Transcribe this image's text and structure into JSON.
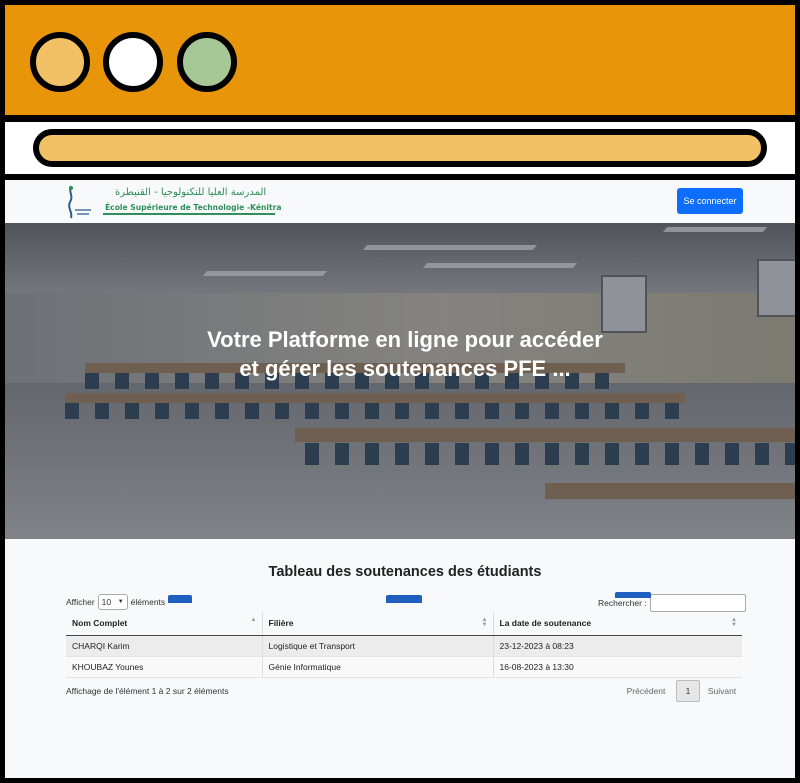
{
  "navbar": {
    "logo_arabic": "المدرسة العليا للتكنولوجيا - القنيطرة",
    "logo_latin": "École Supérieure de Technologie -Kénitra",
    "login_label": "Se connecter"
  },
  "hero": {
    "title": "Votre Platforme en ligne pour accéder et gérer les soutenances PFE ..."
  },
  "table_section": {
    "title": "Tableau des soutenances des étudiants",
    "length_prefix": "Afficher",
    "length_value": "10",
    "length_suffix": "éléments",
    "search_label": "Rechercher :",
    "columns": [
      "Nom Complet",
      "Filière",
      "La date de soutenance"
    ],
    "rows": [
      [
        "CHARQI Karim",
        "Logistique et Transport",
        "23-12-2023 à 08:23"
      ],
      [
        "KHOUBAZ Younes",
        "Génie Informatique",
        "16-08-2023 à 13:30"
      ]
    ],
    "info": "Affichage de l'élément 1 à 2 sur 2 éléments",
    "pagination": {
      "previous": "Précédent",
      "current": "1",
      "next": "Suivant"
    }
  },
  "colors": {
    "titlebar": "#e8950a",
    "primary_button": "#0d6efd",
    "logo_green": "#2f8f5a"
  }
}
